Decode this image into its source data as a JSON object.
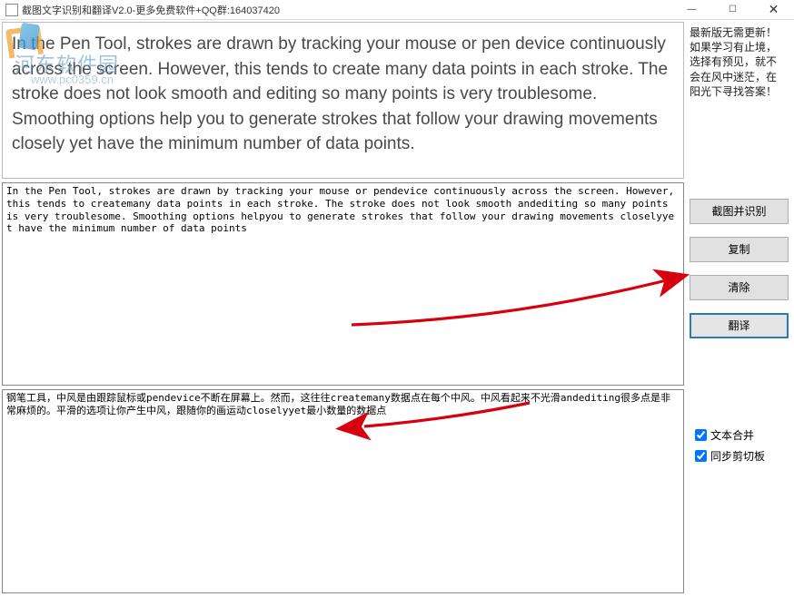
{
  "window": {
    "title": "截图文字识别和翻译V2.0-更多免费软件+QQ群:164037420",
    "controls": {
      "min": "—",
      "max": "☐",
      "close": "✕"
    }
  },
  "watermark": {
    "line1": "河东软件园",
    "line2": "www.pc0359.cn"
  },
  "source_text": "In the Pen Tool, strokes are drawn by tracking your mouse or pen device continuously across the screen. However, this tends to create many data points in each stroke. The stroke does not look smooth and editing so many points is very troublesome. Smoothing options help you to generate strokes that follow your drawing movements closely yet have the minimum number of data points.",
  "ocr_text": "In the Pen Tool, strokes are drawn by tracking your mouse or pendevice continuously across the screen. However, this tends to createmany data points in each stroke. The stroke does not look smooth andediting so many points is very troublesome. Smoothing options helpyou to generate strokes that follow your drawing movements closelyyet have the minimum number of data points",
  "translated_text": "钢笔工具，中风是由跟踪鼠标或pendevice不断在屏幕上。然而，这往往createmany数据点在每个中风。中风看起来不光滑andediting很多点是非常麻烦的。平滑的选项让你产生中风，跟随你的画运动closelyyet最小数量的数据点",
  "right_panel": {
    "info_lines": "最新版无需更新！\n如果学习有止境，\n选择有预见，就不\n会在风中迷茫，在\n阳光下寻找答案！",
    "buttons": {
      "capture_recognize": "截图并识别",
      "copy": "复制",
      "clear": "清除",
      "translate": "翻译"
    },
    "checkboxes": {
      "merge_text": "文本合并",
      "sync_clipboard": "同步剪切板"
    }
  },
  "colors": {
    "arrow": "#d6000f"
  }
}
